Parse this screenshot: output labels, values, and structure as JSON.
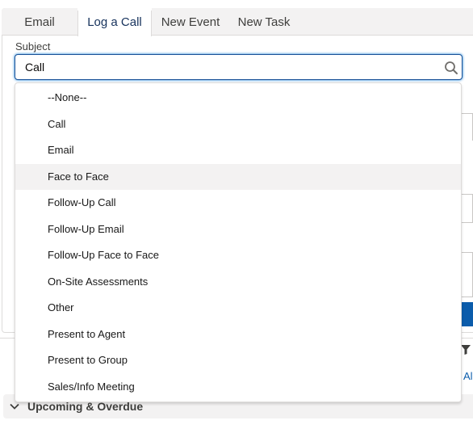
{
  "tabs": [
    {
      "label": "Email"
    },
    {
      "label": "Log a Call"
    },
    {
      "label": "New Event"
    },
    {
      "label": "New Task"
    }
  ],
  "active_tab": "Log a Call",
  "subject": {
    "label": "Subject",
    "value": "Call",
    "icon": "search-icon"
  },
  "dropdown": {
    "options": [
      {
        "label": "--None--"
      },
      {
        "label": "Call"
      },
      {
        "label": "Email"
      },
      {
        "label": "Face to Face"
      },
      {
        "label": "Follow-Up Call"
      },
      {
        "label": "Follow-Up Email"
      },
      {
        "label": "Follow-Up Face to Face"
      },
      {
        "label": "On-Site Assessments"
      },
      {
        "label": "Other"
      },
      {
        "label": "Present to Agent"
      },
      {
        "label": "Present to Group"
      },
      {
        "label": "Sales/Info Meeting"
      }
    ],
    "highlighted": "Face to Face"
  },
  "activity": {
    "filter_icon": "filter-icon",
    "all_link": "Al",
    "upcoming_label": "Upcoming & Overdue",
    "upcoming_icon": "chevron-down-icon"
  },
  "colors": {
    "accent": "#0b5cab",
    "active_tab_text": "#16325c",
    "hover_bg": "#f3f2f2"
  }
}
